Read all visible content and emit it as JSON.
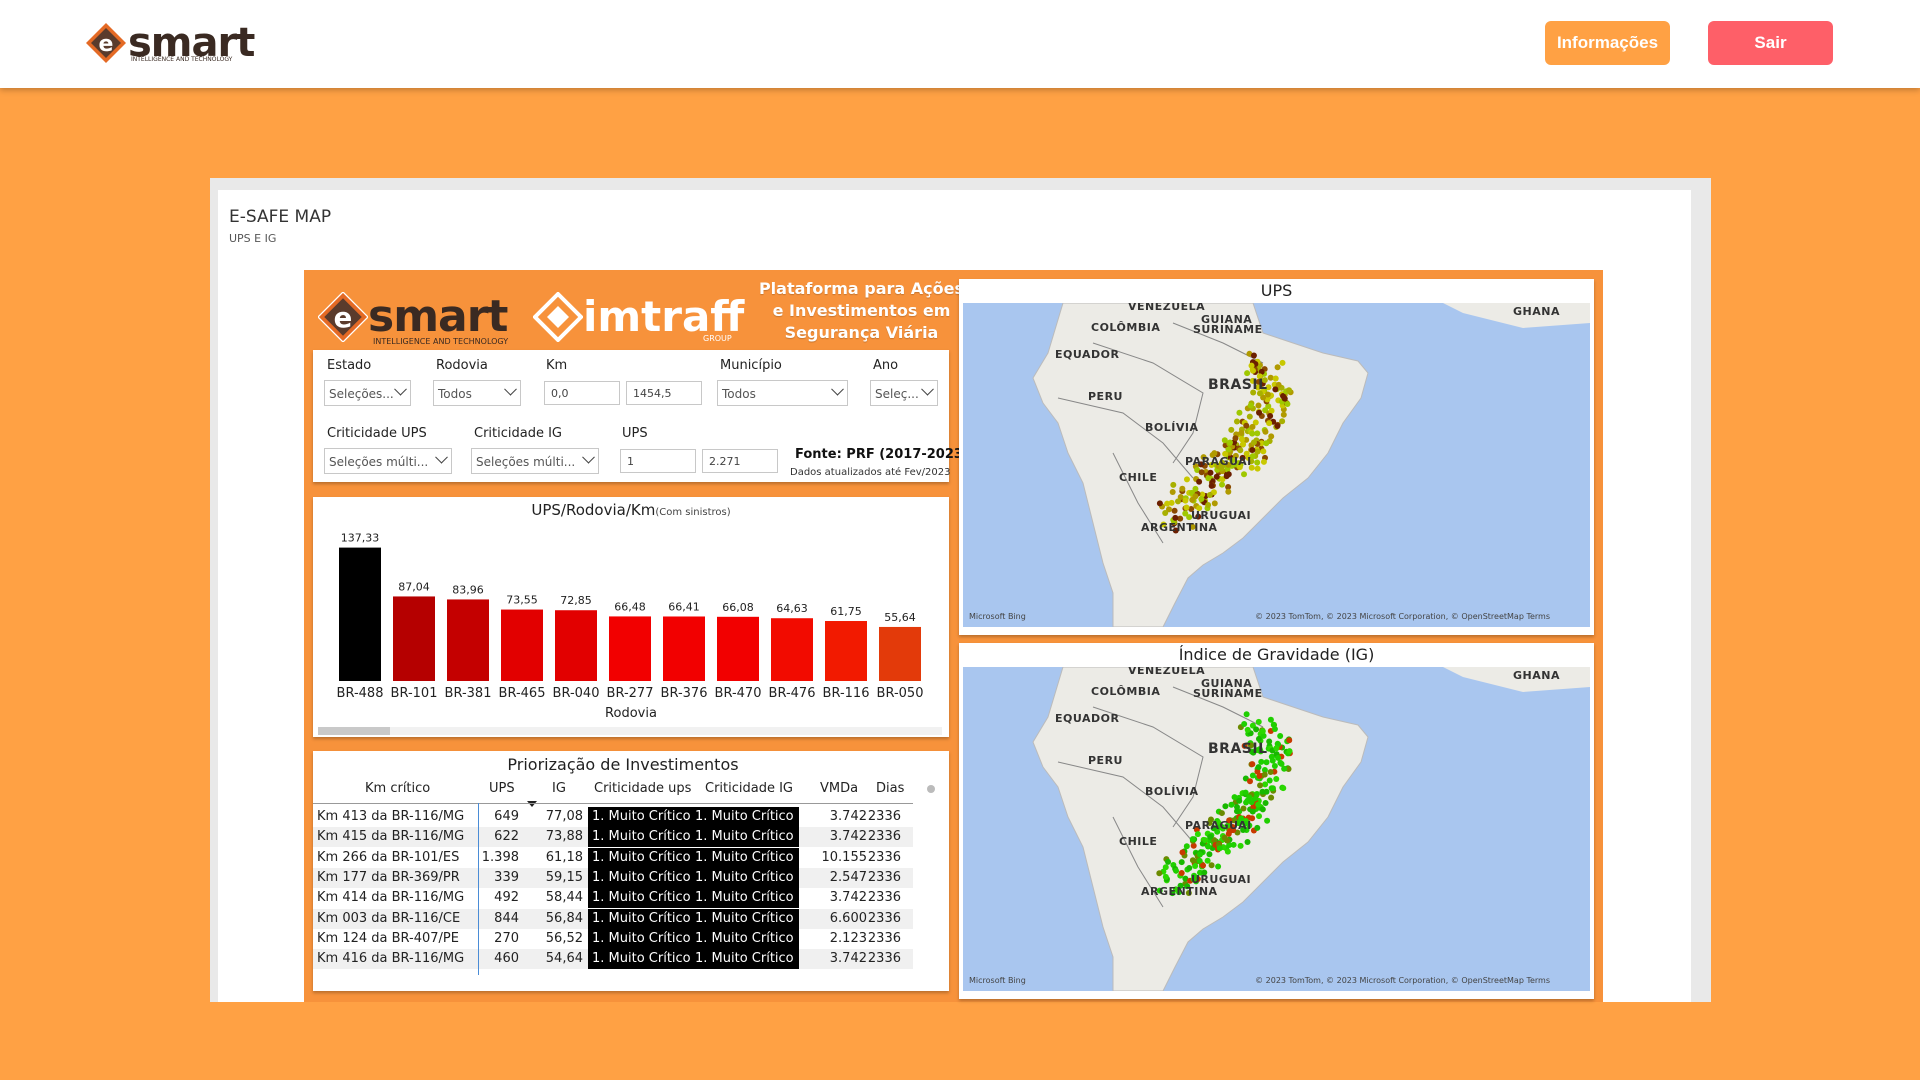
{
  "topbar": {
    "logo_word": "smart",
    "logo_tagline": "INTELLIGENCE AND TECHNOLOGY",
    "info_label": "Informações",
    "exit_label": "Sair"
  },
  "report": {
    "title": "E-SAFE MAP",
    "subtitle": "UPS E IG"
  },
  "header": {
    "smart_word": "smart",
    "smart_tagline": "INTELLIGENCE AND TECHNOLOGY",
    "imtraff_word": "imtraff",
    "imtraff_tag": "GROUP",
    "title_line1": "Plataforma para Ações",
    "title_line2": "e Investimentos em",
    "title_line3": "Segurança Viária"
  },
  "filters": {
    "estado_label": "Estado",
    "estado_value": "Seleções...",
    "rodovia_label": "Rodovia",
    "rodovia_value": "Todos",
    "km_label": "Km",
    "km_min": "0,0",
    "km_max": "1454,5",
    "municipio_label": "Município",
    "municipio_value": "Todos",
    "ano_label": "Ano",
    "ano_value": "Seleç...",
    "crit_ups_label": "Criticidade UPS",
    "crit_ups_value": "Seleções múlti...",
    "crit_ig_label": "Criticidade IG",
    "crit_ig_value": "Seleções múlti...",
    "ups_label": "UPS",
    "ups_min": "1",
    "ups_max": "2.271",
    "fonte": "Fonte: PRF (2017-2023)",
    "atualizado": "Dados atualizados até Fev/2023"
  },
  "chart_data": {
    "type": "bar",
    "title": "UPS/Rodovia/Km",
    "subtitle": "(Com sinistros)",
    "xlabel": "Rodovia",
    "ylabel": "",
    "categories": [
      "BR-488",
      "BR-101",
      "BR-381",
      "BR-465",
      "BR-040",
      "BR-277",
      "BR-376",
      "BR-470",
      "BR-476",
      "BR-116",
      "BR-050"
    ],
    "values": [
      137.33,
      87.04,
      83.96,
      73.55,
      72.85,
      66.48,
      66.41,
      66.08,
      64.63,
      61.75,
      55.64
    ],
    "value_labels": [
      "137,33",
      "87,04",
      "83,96",
      "73,55",
      "72,85",
      "66,48",
      "66,41",
      "66,08",
      "64,63",
      "61,75",
      "55,64"
    ],
    "colors": [
      "#000000",
      "#b50000",
      "#c40000",
      "#e20000",
      "#e20000",
      "#f20000",
      "#f20000",
      "#f20000",
      "#f20b00",
      "#f21a00",
      "#e33a0a"
    ],
    "ylim": [
      0,
      140
    ]
  },
  "table": {
    "title": "Priorização de Investimentos",
    "columns": [
      "Km crítico",
      "UPS",
      "IG",
      "Criticidade ups",
      "Criticidade IG",
      "VMDa",
      "Dias"
    ],
    "rows": [
      [
        "Km 413 da BR-116/MG",
        "649",
        "77,08",
        "1. Muito Crítico",
        "1. Muito Crítico",
        "3.742",
        "2336"
      ],
      [
        "Km 415 da BR-116/MG",
        "622",
        "73,88",
        "1. Muito Crítico",
        "1. Muito Crítico",
        "3.742",
        "2336"
      ],
      [
        "Km 266 da BR-101/ES",
        "1.398",
        "61,18",
        "1. Muito Crítico",
        "1. Muito Crítico",
        "10.155",
        "2336"
      ],
      [
        "Km 177 da BR-369/PR",
        "339",
        "59,15",
        "1. Muito Crítico",
        "1. Muito Crítico",
        "2.547",
        "2336"
      ],
      [
        "Km 414 da BR-116/MG",
        "492",
        "58,44",
        "1. Muito Crítico",
        "1. Muito Crítico",
        "3.742",
        "2336"
      ],
      [
        "Km 003 da BR-116/CE",
        "844",
        "56,84",
        "1. Muito Crítico",
        "1. Muito Crítico",
        "6.600",
        "2336"
      ],
      [
        "Km 124 da BR-407/PE",
        "270",
        "56,52",
        "1. Muito Crítico",
        "1. Muito Crítico",
        "2.123",
        "2336"
      ],
      [
        "Km 416 da BR-116/MG",
        "460",
        "54,64",
        "1. Muito Crítico",
        "1. Muito Crítico",
        "3.742",
        "2336"
      ]
    ]
  },
  "maps": {
    "ups_title": "UPS",
    "ig_title": "Índice de Gravidade (IG)",
    "labels": {
      "venezuela": "VENEZUELA",
      "guiana": "GUIANA",
      "ghana": "GHANA",
      "colombia": "COLÔMBIA",
      "suriname": "SURINAME",
      "equador": "EQUADOR",
      "brasil": "BRASIL",
      "peru": "PERU",
      "bolivia": "BOLÍVIA",
      "paraguai": "PARAGUAI",
      "chile": "CHILE",
      "uruguai": "URUGUAI",
      "argentina": "ARGENTINA"
    },
    "bing": "Microsoft Bing",
    "copyright": "© 2023 TomTom, © 2023 Microsoft Corporation, © OpenStreetMap   Terms"
  }
}
